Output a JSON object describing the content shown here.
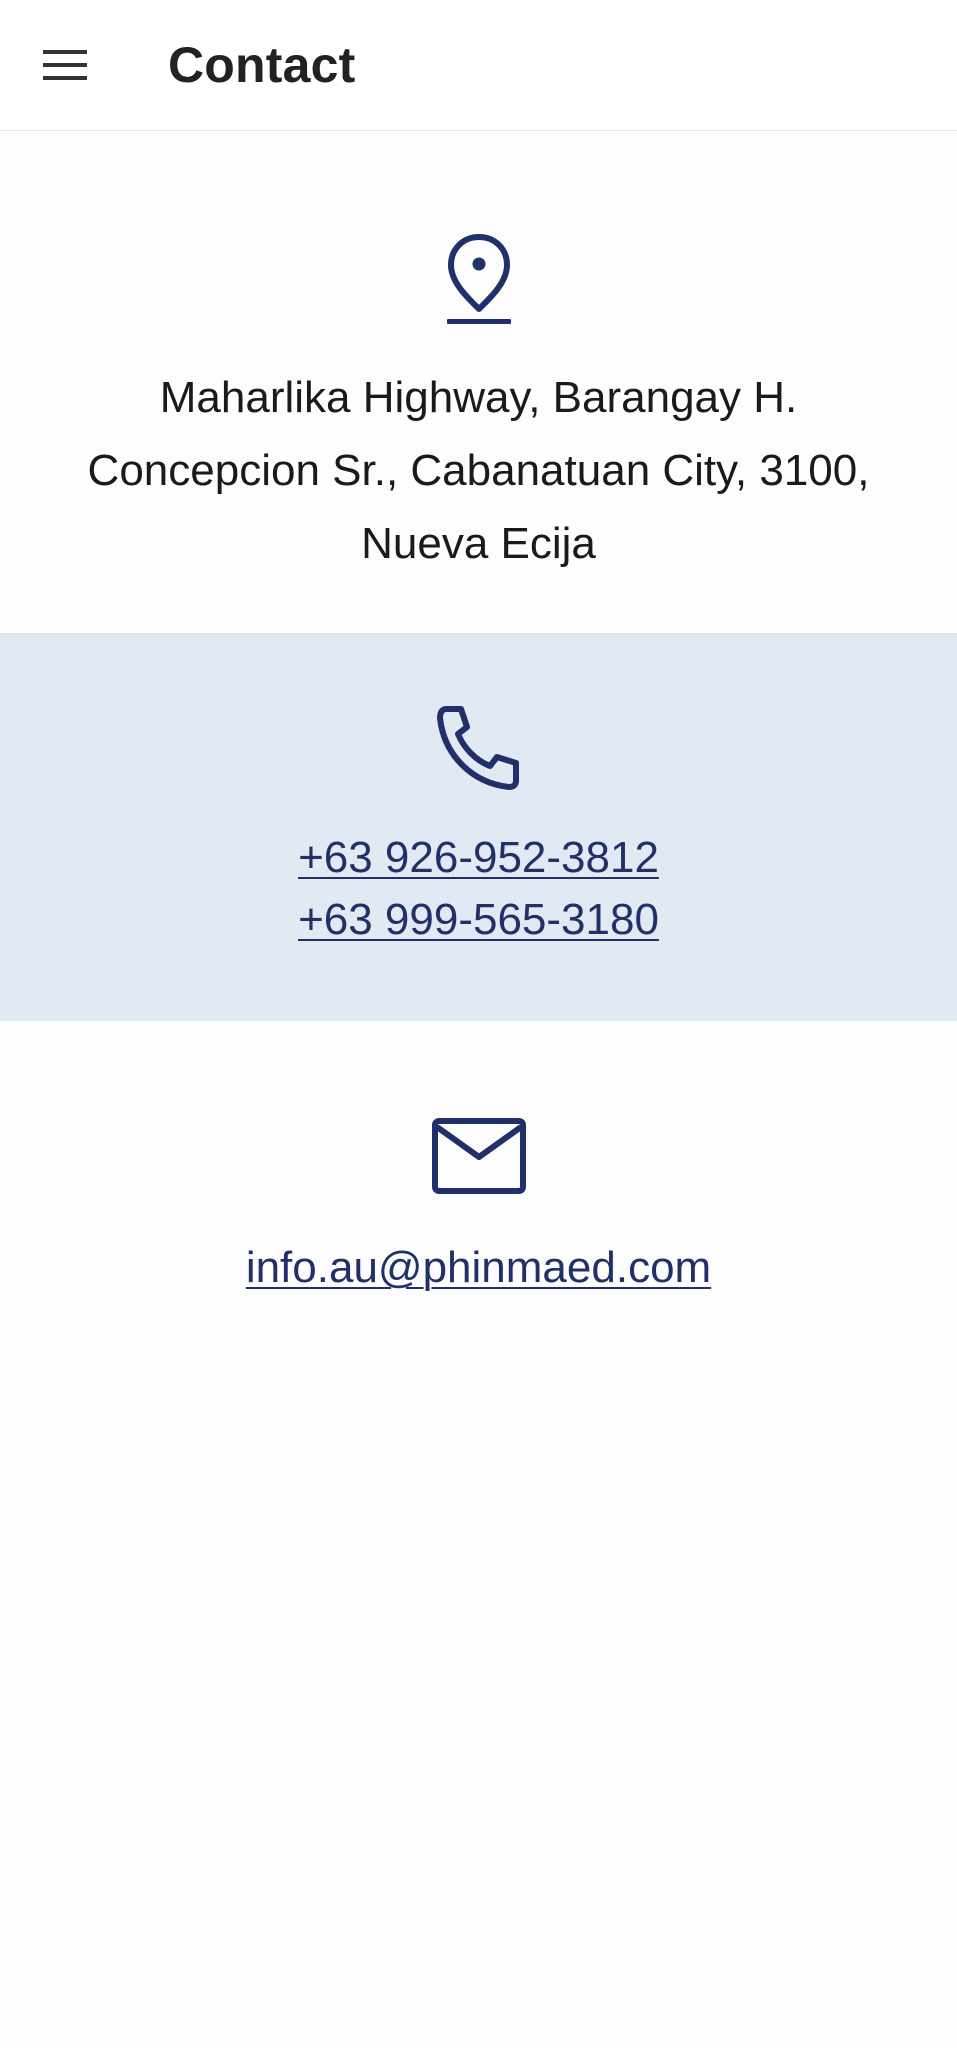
{
  "header": {
    "title": "Contact",
    "menu_icon": "hamburger-menu-icon"
  },
  "address": {
    "icon": "map-pin-icon",
    "text": "Maharlika Highway, Barangay H. Concepcion Sr., Cabanatuan City, 3100, Nueva Ecija"
  },
  "phone": {
    "icon": "phone-icon",
    "numbers": [
      "+63 926-952-3812",
      "+63 999-565-3180"
    ]
  },
  "email": {
    "icon": "mail-icon",
    "address": "info.au@phinmaed.com"
  },
  "colors": {
    "accent": "#22306a",
    "phone_section_bg": "#e1eaf3",
    "background": "#fdfdfd",
    "title_text": "#222222"
  }
}
